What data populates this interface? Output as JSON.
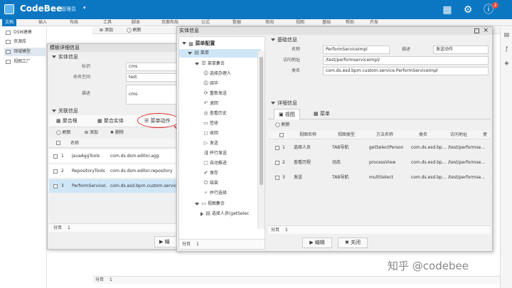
{
  "app": {
    "name": "CodeBee",
    "user": "管理员",
    "user_caret": "▾",
    "badge": "2"
  },
  "menubar": {
    "items": [
      "文档",
      "插入",
      "布局",
      "工具",
      "脚本",
      "页面布局",
      "公式",
      "数据",
      "审阅",
      "视图",
      "基础",
      "帮助",
      "开发"
    ]
  },
  "leftnav": {
    "items": [
      "DSM建模",
      "资源库",
      "领域模型",
      "视图工厂"
    ]
  },
  "bg": {
    "toolbar_add": "添加",
    "toolbar_refresh": "刷新",
    "pagination": "分页",
    "page": "1"
  },
  "template_window": {
    "title": "模板详细信息",
    "entity_section": "实体信息",
    "fields": [
      {
        "label": "标识",
        "value": "cms"
      },
      {
        "label": "命名空间",
        "value": "test"
      },
      {
        "label": "描述",
        "value": "cms"
      }
    ],
    "related_section": "关联信息",
    "tabs": [
      "聚合根",
      "聚合实体",
      "菜单动作"
    ],
    "toolbar": {
      "refresh": "刷新",
      "add": "添加",
      "delete": "删除"
    },
    "table_header": "名称",
    "rows": [
      {
        "idx": "1",
        "name": "JavaAggTools",
        "path": "com.ds.dsm.editor.agg"
      },
      {
        "idx": "2",
        "name": "RepositoryTools",
        "path": "com.ds.dsm.editor.repository"
      },
      {
        "idx": "3",
        "name": "PerformServiceI...",
        "path": "com.ds.esd.bpm.custom.service"
      }
    ],
    "pagination": "分页",
    "page": "1",
    "edit_button": "编"
  },
  "entity_window": {
    "title": "实体信息",
    "tree": [
      {
        "label": "菜单配置",
        "level": 0,
        "icon": "menu-config-icon",
        "glyph": "▦"
      },
      {
        "label": "菜单",
        "level": 1,
        "icon": "menu-icon",
        "glyph": "▤"
      },
      {
        "label": "菜单集合",
        "level": 2,
        "icon": "menu-collection-icon",
        "glyph": "☰"
      },
      {
        "label": "选择办理人",
        "level": 3,
        "icon": "select-handler-icon",
        "glyph": "👤"
      },
      {
        "label": "阅毕",
        "level": 3,
        "icon": "read-done-icon",
        "glyph": "👤"
      },
      {
        "label": "重新发送",
        "level": 3,
        "icon": "resend-icon",
        "glyph": "⟳"
      },
      {
        "label": "退回",
        "level": 3,
        "icon": "return-icon",
        "glyph": "↶"
      },
      {
        "label": "查看历史",
        "level": 3,
        "icon": "history-icon",
        "glyph": "◎"
      },
      {
        "label": "签收",
        "level": 3,
        "icon": "sign-icon",
        "glyph": "▭"
      },
      {
        "label": "收回",
        "level": 3,
        "icon": "retract-icon",
        "glyph": "◻"
      },
      {
        "label": "发送",
        "level": 3,
        "icon": "send-icon",
        "glyph": "▷"
      },
      {
        "label": "并行发送",
        "level": 3,
        "icon": "parallel-send-icon",
        "glyph": "⇶"
      },
      {
        "label": "自动推进",
        "level": 3,
        "icon": "auto-advance-icon",
        "glyph": "▢"
      },
      {
        "label": "保存",
        "level": 3,
        "icon": "save-icon",
        "glyph": "✔"
      },
      {
        "label": "结束",
        "level": 3,
        "icon": "end-icon",
        "glyph": "⏻"
      },
      {
        "label": "并行选择",
        "level": 3,
        "icon": "parallel-select-icon",
        "glyph": "⑂"
      },
      {
        "label": "视图集合",
        "level": 2,
        "icon": "view-collection-icon",
        "glyph": "▭"
      },
      {
        "label": "选择人员(getSelec",
        "level": 3,
        "icon": "select-person-icon",
        "glyph": "▸"
      }
    ],
    "pagination": "分页",
    "page": "1"
  },
  "detail_panel": {
    "basic_section": "基础信息",
    "name_label": "名称",
    "name_value": "PerformServiceImpl",
    "desc_label": "描述",
    "desc_value": "发送动作",
    "url_label": "访问地址",
    "url_value": "/test/performserviceimpl/",
    "class_label": "类名",
    "class_value": "com.ds.esd.bpm.custom.service.PerformServiceImpl",
    "detail_section": "详细信息",
    "tabs": [
      "视图",
      "菜单"
    ],
    "refresh": "刷新",
    "columns": [
      "视图名称",
      "视图类型",
      "方法名称",
      "类名",
      "访问地址",
      "使"
    ],
    "rows": [
      {
        "idx": "1",
        "view": "选择人员",
        "type": "TAB导航",
        "method": "getSelectPerson",
        "cls": "com.ds.esd.bp...",
        "url": "/test/performse..."
      },
      {
        "idx": "2",
        "view": "查看历程",
        "type": "动态",
        "method": "processView",
        "cls": "com.ds.esd.bp...",
        "url": "/test/performse..."
      },
      {
        "idx": "3",
        "view": "发送",
        "type": "TAB导航",
        "method": "multiSelect",
        "cls": "com.ds.esd.bp...",
        "url": "/test/performse..."
      }
    ],
    "pagination": "分页",
    "page": "1",
    "edit_button": "编辑",
    "close_button": "关闭"
  },
  "watermark": "知乎 @codebee",
  "colors": {
    "brand": "#0b77c2",
    "selected_row": "#cfe6f7",
    "highlight_circle": "#e0302a"
  }
}
